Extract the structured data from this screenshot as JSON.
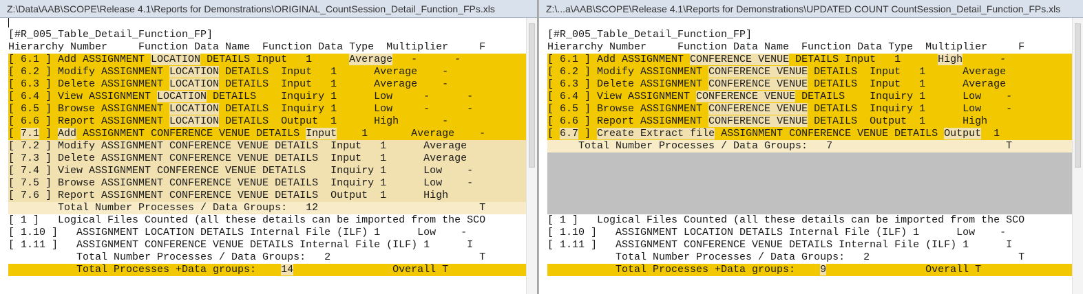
{
  "colors": {
    "gold": "#f2c800",
    "tan": "#f2e1b0",
    "gray": "#c0c0c0",
    "title_bg": "#d9e1ec"
  },
  "left": {
    "title": "Z:\\Data\\AAB\\SCOPE\\Release 4.1\\Reports for Demonstrations\\ORIGINAL_CountSession_Detail_Function_FPs.xls",
    "lines": [
      {
        "text": "[#R_005_Table_Detail_Function_FP]",
        "style": "plain"
      },
      {
        "text": "Hierarchy Number     Function Data Name  Function Data Type  Multiplier     F",
        "style": "plain"
      },
      {
        "style": "gold",
        "parts": [
          "[ 6.1 ] Add ASSIGNMENT ",
          {
            "t": "LOCATION",
            "h": 1
          },
          " DETAILS Input   1      ",
          {
            "t": "Average",
            "h": 1
          },
          "   -      -"
        ]
      },
      {
        "style": "gold",
        "parts": [
          "[ 6.2 ] Modify ASSIGNMENT ",
          {
            "t": "LOCATION",
            "h": 1
          },
          " DETAILS  Input   1      Average    -"
        ]
      },
      {
        "style": "gold",
        "parts": [
          "[ 6.3 ] Delete ASSIGNMENT ",
          {
            "t": "LOCATION",
            "h": 1
          },
          " DETAILS  Input   1      Average    -"
        ]
      },
      {
        "style": "gold",
        "parts": [
          "[ 6.4 ] View ASSIGNMENT ",
          {
            "t": "LOCATION",
            "h": 1
          },
          " DETAILS    Inquiry 1      Low     -      -"
        ]
      },
      {
        "style": "gold",
        "parts": [
          "[ 6.5 ] Browse ASSIGNMENT ",
          {
            "t": "LOCATION",
            "h": 1
          },
          " DETAILS  Inquiry 1      Low     -      -"
        ]
      },
      {
        "style": "gold",
        "parts": [
          "[ 6.6 ] Report ASSIGNMENT ",
          {
            "t": "LOCATION",
            "h": 1
          },
          " DETAILS  Output  1      High       -"
        ]
      },
      {
        "style": "gold",
        "parts": [
          "[ ",
          {
            "t": "7.1",
            "h": 1
          },
          " ] ",
          {
            "t": "Add",
            "h": 1
          },
          " ASSIGNMENT CONFERENCE VENUE DETAILS ",
          {
            "t": "Input",
            "h": 1
          },
          "    1       Average    -"
        ]
      },
      {
        "style": "tan",
        "text": "[ 7.2 ] Modify ASSIGNMENT CONFERENCE VENUE DETAILS  Input   1      Average"
      },
      {
        "style": "tan",
        "text": "[ 7.3 ] Delete ASSIGNMENT CONFERENCE VENUE DETAILS  Input   1      Average"
      },
      {
        "style": "tan",
        "text": "[ 7.4 ] View ASSIGNMENT CONFERENCE VENUE DETAILS    Inquiry 1      Low    -"
      },
      {
        "style": "tan",
        "text": "[ 7.5 ] Browse ASSIGNMENT CONFERENCE VENUE DETAILS  Inquiry 1      Low    -"
      },
      {
        "style": "tan",
        "text": "[ 7.6 ] Report ASSIGNMENT CONFERENCE VENUE DETAILS  Output  1      High"
      },
      {
        "style": "pale",
        "text": "        Total Number Processes / Data Groups:   12                          T"
      },
      {
        "style": "plain",
        "text": "[ 1 ]   Logical Files Counted (all these details can be imported from the SCO"
      },
      {
        "style": "plain",
        "text": "[ 1.10 ]   ASSIGNMENT LOCATION DETAILS Internal File (ILF) 1      Low    -"
      },
      {
        "style": "plain",
        "text": "[ 1.11 ]   ASSIGNMENT CONFERENCE VENUE DETAILS Internal File (ILF) 1      I"
      },
      {
        "style": "plain",
        "text": "           Total Number Processes / Data Groups:   2                        T"
      },
      {
        "style": "gold",
        "parts": [
          "           Total Processes +Data groups:    ",
          {
            "t": "14",
            "h": 1
          },
          "                Overall T"
        ]
      }
    ]
  },
  "right": {
    "title": "Z:\\...a\\AAB\\SCOPE\\Release 4.1\\Reports for Demonstrations\\UPDATED COUNT CountSession_Detail_Function_FPs.xls",
    "lines": [
      {
        "text": "[#R_005_Table_Detail_Function_FP]",
        "style": "plain"
      },
      {
        "text": "Hierarchy Number     Function Data Name  Function Data Type  Multiplier     F",
        "style": "plain"
      },
      {
        "style": "gold",
        "parts": [
          "[ 6.1 ] Add ASSIGNMENT ",
          {
            "t": "CONFERENCE VENUE",
            "h": 1
          },
          " DETAILS Input   1      ",
          {
            "t": "High",
            "h": 1
          },
          "      -"
        ]
      },
      {
        "style": "gold",
        "parts": [
          "[ 6.2 ] Modify ASSIGNMENT ",
          {
            "t": "CONFERENCE VENUE",
            "h": 1
          },
          " DETAILS  Input   1      Average"
        ]
      },
      {
        "style": "gold",
        "parts": [
          "[ 6.3 ] Delete ASSIGNMENT ",
          {
            "t": "CONFERENCE VENUE",
            "h": 1
          },
          " DETAILS  Input   1      Average"
        ]
      },
      {
        "style": "gold",
        "parts": [
          "[ 6.4 ] View ASSIGNMENT ",
          {
            "t": "CONFERENCE VENUE",
            "h": 1
          },
          " DETAILS    Inquiry 1      Low    -"
        ]
      },
      {
        "style": "gold",
        "parts": [
          "[ 6.5 ] Browse ASSIGNMENT ",
          {
            "t": "CONFERENCE VENUE",
            "h": 1
          },
          " DETAILS  Inquiry 1      Low    -"
        ]
      },
      {
        "style": "gold",
        "parts": [
          "[ 6.6 ] Report ASSIGNMENT ",
          {
            "t": "CONFERENCE VENUE",
            "h": 1
          },
          " DETAILS  Output  1      High"
        ]
      },
      {
        "style": "gold",
        "parts": [
          "[ ",
          {
            "t": "6.7",
            "h": 1
          },
          " ] ",
          {
            "t": "Create Extract file",
            "h": 1
          },
          " ASSIGNMENT CONFERENCE VENUE DETAILS ",
          {
            "t": "Output",
            "h": 1
          },
          "  1"
        ]
      },
      {
        "style": "pale",
        "text": "     Total Number Processes / Data Groups:   7                            T"
      },
      {
        "style": "gray",
        "rows": 5
      },
      {
        "style": "plain",
        "text": "[ 1 ]   Logical Files Counted (all these details can be imported from the SCO"
      },
      {
        "style": "plain",
        "text": "[ 1.10 ]   ASSIGNMENT LOCATION DETAILS Internal File (ILF) 1      Low    -"
      },
      {
        "style": "plain",
        "text": "[ 1.11 ]   ASSIGNMENT CONFERENCE VENUE DETAILS Internal File (ILF) 1      I"
      },
      {
        "style": "plain",
        "text": "           Total Number Processes / Data Groups:   2                        T"
      },
      {
        "style": "gold",
        "parts": [
          "           Total Processes +Data groups:    ",
          {
            "t": "9",
            "h": 1
          },
          "                Overall T"
        ]
      }
    ]
  }
}
